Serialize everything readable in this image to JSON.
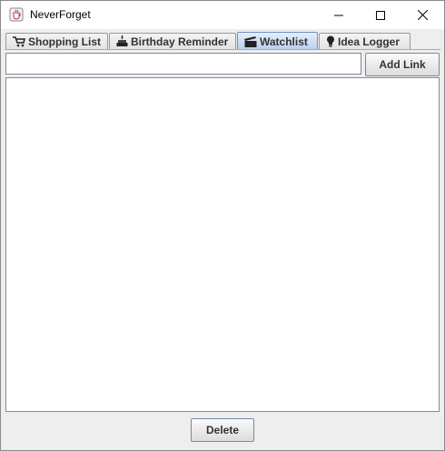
{
  "window": {
    "title": "NeverForget",
    "icon": "java-cup-icon"
  },
  "controls": {
    "minimize_icon": "minimize-icon",
    "maximize_icon": "maximize-icon",
    "close_icon": "close-icon"
  },
  "tabs": [
    {
      "label": "Shopping List",
      "icon": "cart-icon",
      "selected": false
    },
    {
      "label": "Birthday Reminder",
      "icon": "cake-icon",
      "selected": false
    },
    {
      "label": "Watchlist",
      "icon": "clapperboard-icon",
      "selected": true
    },
    {
      "label": "Idea Logger",
      "icon": "lightbulb-icon",
      "selected": false
    }
  ],
  "watchlist": {
    "link_input_value": "",
    "add_button_label": "Add Link",
    "items": [],
    "delete_button_label": "Delete"
  },
  "colors": {
    "selected_tab": "#b8cff0",
    "window_bg": "#eeeeee"
  }
}
